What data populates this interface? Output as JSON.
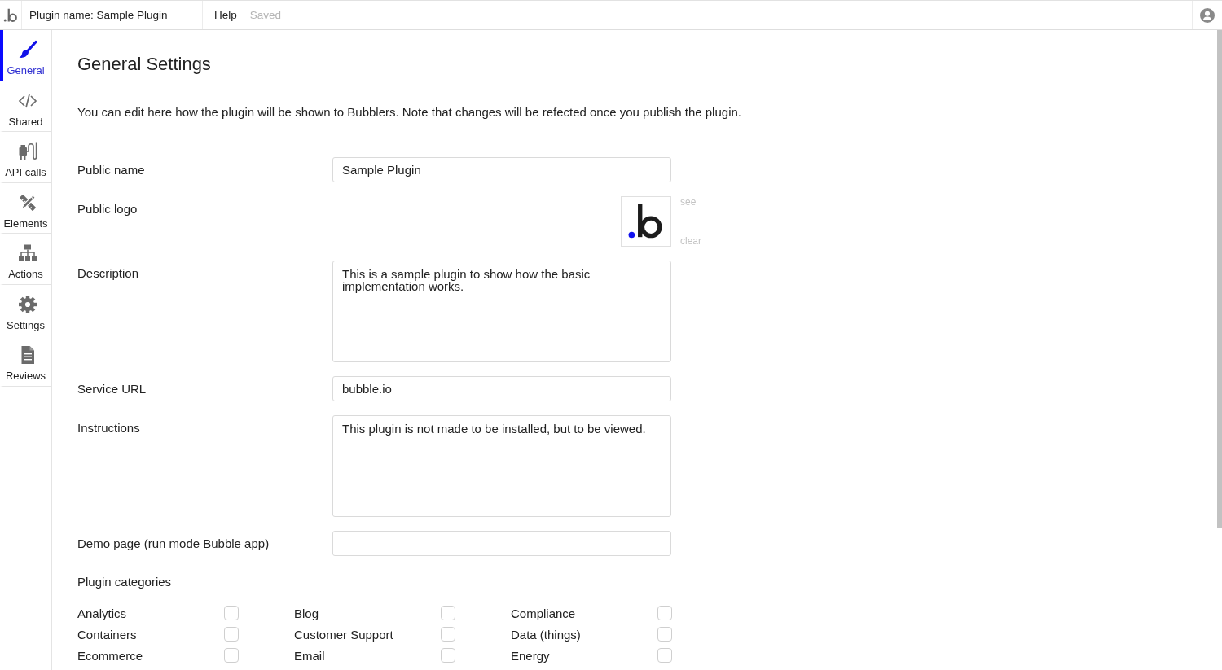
{
  "topbar": {
    "plugin_name": "Plugin name: Sample Plugin",
    "help": "Help",
    "save_status": "Saved"
  },
  "sidebar": {
    "items": [
      {
        "label": "General",
        "kind": "brush",
        "selected": true
      },
      {
        "label": "Shared",
        "kind": "code",
        "selected": false
      },
      {
        "label": "API calls",
        "kind": "plug",
        "selected": false
      },
      {
        "label": "Elements",
        "kind": "tools",
        "selected": false
      },
      {
        "label": "Actions",
        "kind": "sitemap",
        "selected": false
      },
      {
        "label": "Settings",
        "kind": "gear",
        "selected": false
      },
      {
        "label": "Reviews",
        "kind": "document",
        "selected": false
      }
    ]
  },
  "page": {
    "title": "General Settings",
    "intro": "You can edit here how the plugin will be shown to Bubblers. Note that changes will be refected once you publish the plugin."
  },
  "fields": [
    {
      "label": "Public name",
      "kind": "input",
      "value": "Sample Plugin"
    },
    {
      "label": "Public logo",
      "kind": "logo",
      "links": [
        "see",
        "clear"
      ]
    },
    {
      "label": "Description",
      "kind": "textarea",
      "value": "This is a sample plugin to show how the basic implementation works."
    },
    {
      "label": "Service URL",
      "kind": "input",
      "value": "bubble.io"
    },
    {
      "label": "Instructions",
      "kind": "textarea",
      "value": "This plugin is not made to be installed, but to be viewed."
    },
    {
      "label": "Demo page (run mode Bubble app)",
      "kind": "input"
    }
  ],
  "categories": {
    "title": "Plugin categories",
    "items": [
      {
        "label": "Analytics",
        "checked": false
      },
      {
        "label": "Blog",
        "checked": false
      },
      {
        "label": "Compliance",
        "checked": false
      },
      {
        "label": "Containers",
        "checked": false
      },
      {
        "label": "Customer Support",
        "checked": false
      },
      {
        "label": "Data (things)",
        "checked": false
      },
      {
        "label": "Ecommerce",
        "checked": false
      },
      {
        "label": "Email",
        "checked": false
      },
      {
        "label": "Energy",
        "checked": false
      }
    ]
  }
}
